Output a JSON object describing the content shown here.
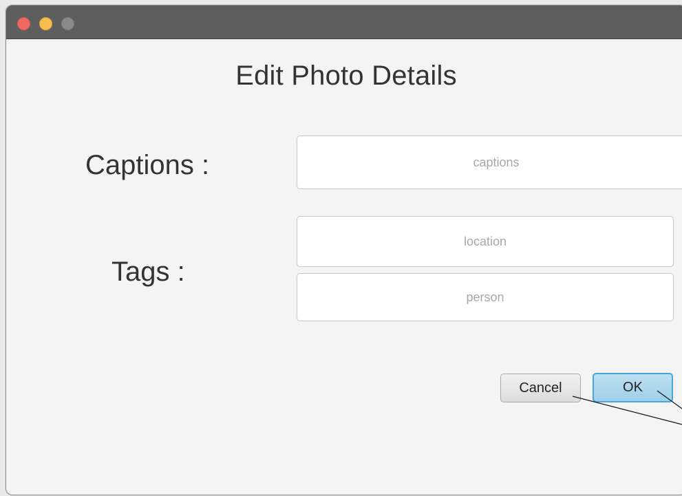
{
  "window": {
    "title": "Edit Photo Details",
    "controls": {
      "close_color": "#ee6a5f",
      "minimize_color": "#f4bf4f",
      "zoom_color": "#8a8a8a"
    }
  },
  "form": {
    "captions_label": "Captions :",
    "tags_label": "Tags :",
    "captions_placeholder": "captions",
    "location_placeholder": "location",
    "person_placeholder": "person",
    "captions_value": "",
    "location_value": "",
    "person_value": ""
  },
  "buttons": {
    "cancel_label": "Cancel",
    "ok_label": "OK",
    "ok_accent": "#4aa3df"
  }
}
